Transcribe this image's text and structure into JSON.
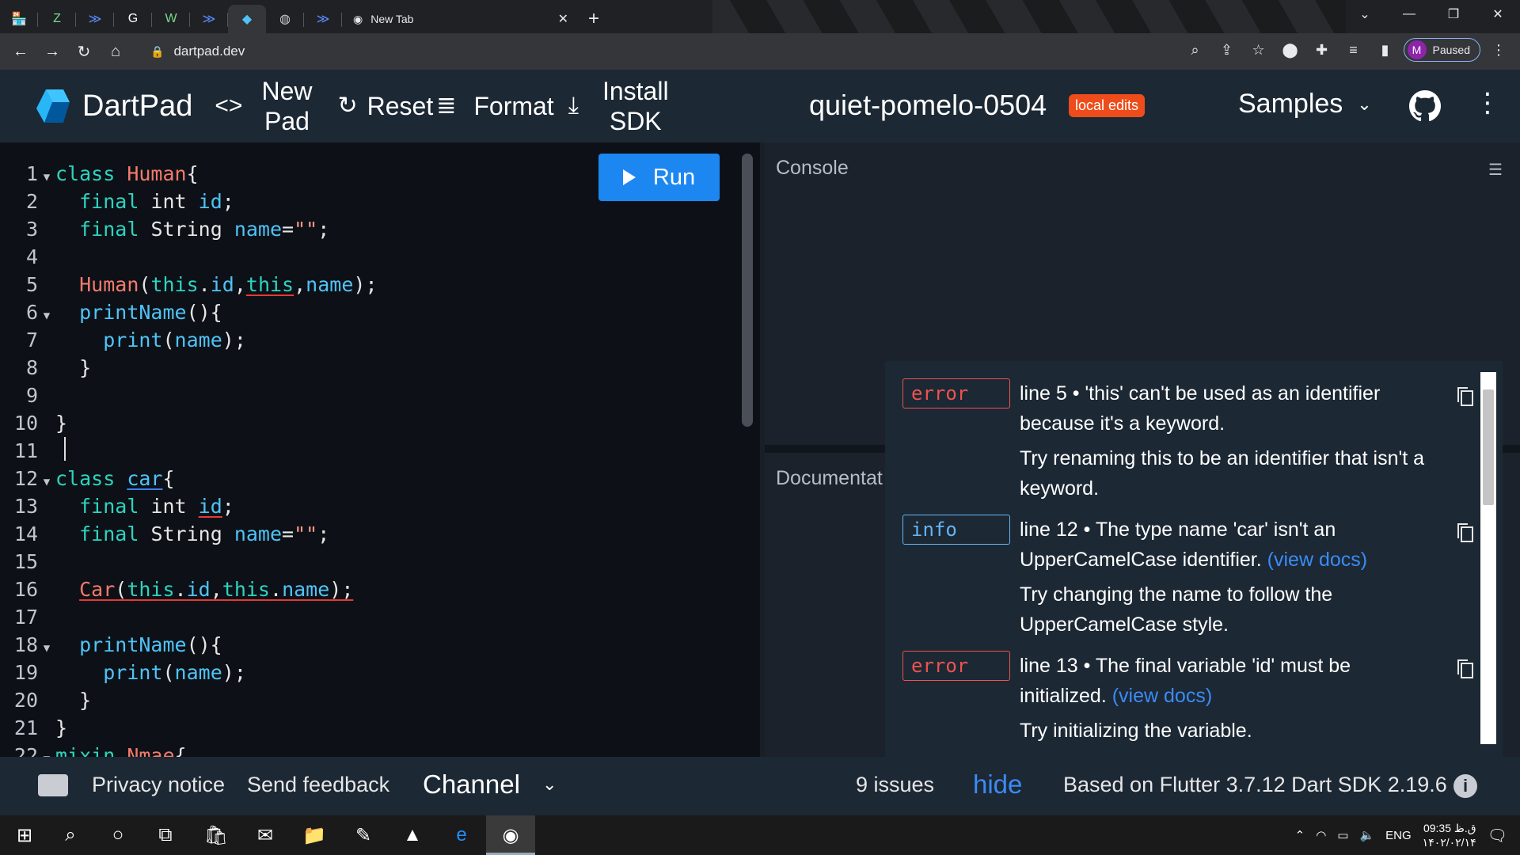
{
  "browser": {
    "active_tab_title": "New Tab",
    "url": "dartpad.dev",
    "profile_initial": "M",
    "profile_status": "Paused"
  },
  "header": {
    "brand": "DartPad",
    "new_pad_line1": "New",
    "new_pad_line2": "Pad",
    "reset_label": "Reset",
    "format_label": "Format",
    "install_line1": "Install",
    "install_line2": "SDK",
    "pad_name": "quiet-pomelo-0504",
    "badge": "local edits",
    "samples_label": "Samples"
  },
  "editor": {
    "run_label": "Run",
    "line_numbers": [
      "1",
      "2",
      "3",
      "4",
      "5",
      "6",
      "7",
      "8",
      "9",
      "10",
      "11",
      "12",
      "13",
      "14",
      "15",
      "16",
      "17",
      "18",
      "19",
      "20",
      "21",
      "22"
    ]
  },
  "panes": {
    "console_label": "Console",
    "docs_label": "Documentat"
  },
  "issues": [
    {
      "kind": "error",
      "message": "line 5 • 'this' can't be used as an identifier because it's a keyword.",
      "correction": "Try renaming this to be an identifier that isn't a keyword."
    },
    {
      "kind": "info",
      "message": "line 12 • The type name 'car' isn't an UpperCamelCase identifier.",
      "link": "(view docs)",
      "correction": "Try changing the name to follow the UpperCamelCase style."
    },
    {
      "kind": "error",
      "message": "line 13 • The final variable 'id' must be initialized.",
      "link": "(view docs)",
      "correction": "Try initializing the variable."
    }
  ],
  "footer": {
    "privacy": "Privacy notice",
    "feedback": "Send feedback",
    "channel": "Channel",
    "issues_count": "9 issues",
    "hide": "hide",
    "version": "Based on Flutter 3.7.12 Dart SDK 2.19.6"
  },
  "taskbar": {
    "lang": "ENG",
    "time": "09:35 ق.ظ",
    "date": "۱۴۰۲/۰۲/۱۴"
  },
  "colors": {
    "run_button": "#1c87f0",
    "badge": "#ee4c1a",
    "error": "#ef5350",
    "info": "#64b5f6",
    "link": "#3b8bf5"
  }
}
